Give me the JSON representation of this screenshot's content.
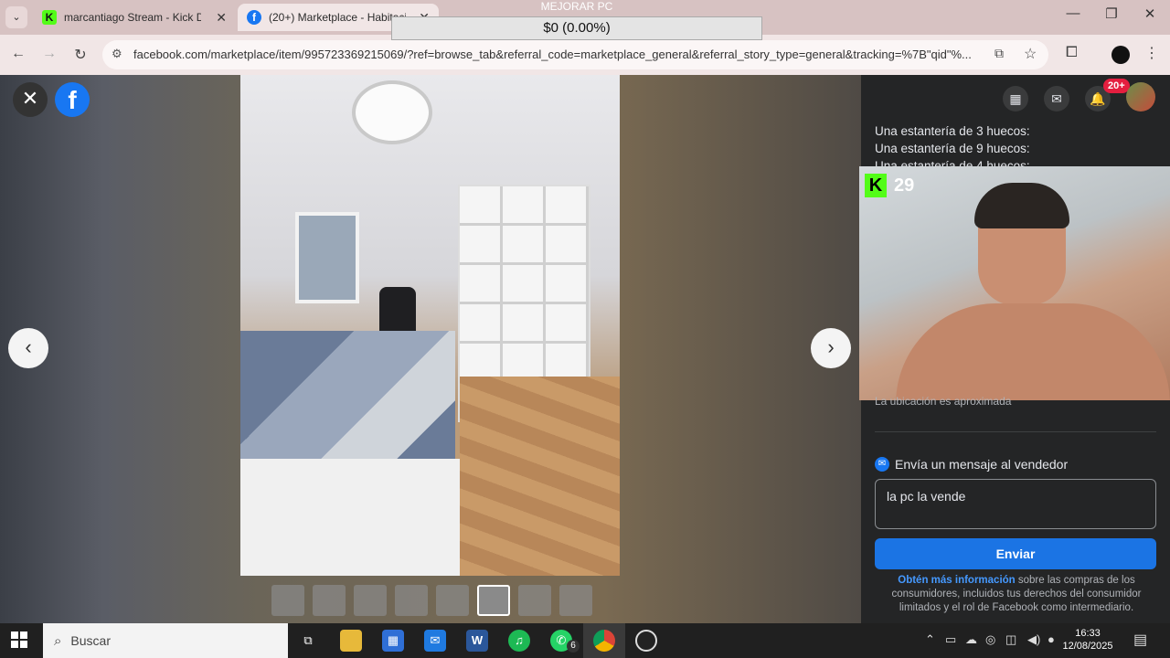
{
  "browser": {
    "tabs": [
      {
        "title": "marcantiago Stream - Kick Dash",
        "favicon": "kick-icon",
        "color": "#53fc18"
      },
      {
        "title": "(20+) Marketplace - Habitació",
        "favicon": "facebook-icon",
        "color": "#1877f2"
      }
    ],
    "url": "facebook.com/marketplace/item/995723369215069/?ref=browse_tab&referral_code=marketplace_general&referral_story_type=general&tracking=%7B\"qid\"%..."
  },
  "overlay": {
    "title": "MEJORAR PC",
    "value": "$0 (0.00%)"
  },
  "header": {
    "notifications_badge": "20+"
  },
  "listing": {
    "description_lines": [
      "Una estantería de 3 huecos:",
      "Una estantería de 9 huecos:",
      "Una estantería de 4 huecos:"
    ],
    "location_note": "La ubicación es aproximada"
  },
  "stream": {
    "viewer_count": "29"
  },
  "message": {
    "heading": "Envía un mensaje al vendedor",
    "input_value": "la pc la vende",
    "send_label": "Enviar",
    "legal_link": "Obtén más información",
    "legal_text": " sobre las compras de los consumidores, incluidos tus derechos del consumidor limitados y el rol de Facebook como intermediario."
  },
  "taskbar": {
    "search_placeholder": "Buscar",
    "whatsapp_badge": "6",
    "time": "16:33",
    "date": "12/08/2025"
  }
}
